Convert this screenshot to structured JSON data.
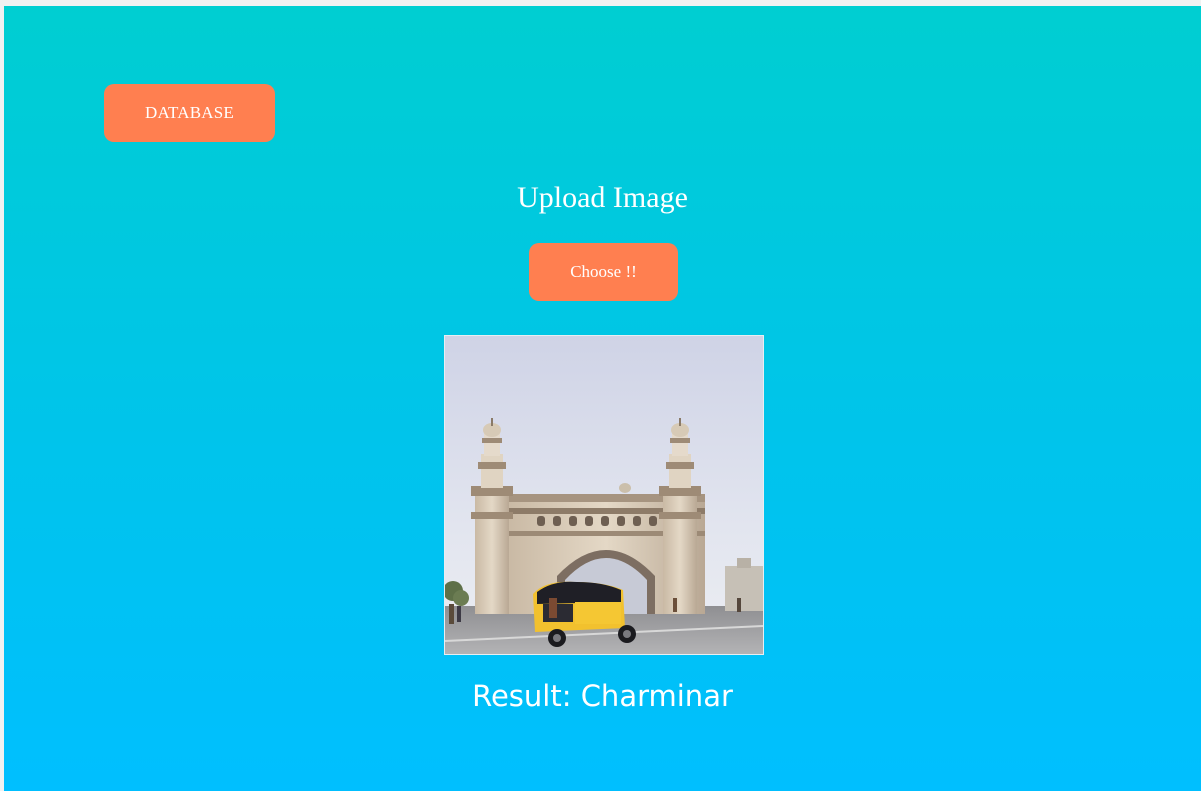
{
  "nav": {
    "database_label": "DATABASE"
  },
  "upload": {
    "title": "Upload Image",
    "choose_label": "Choose !!"
  },
  "result": {
    "text": "Result: Charminar"
  },
  "colors": {
    "background_top": "#00ced1",
    "background_bottom": "#00bfff",
    "button": "#ff7f50",
    "text": "#ffffff"
  }
}
